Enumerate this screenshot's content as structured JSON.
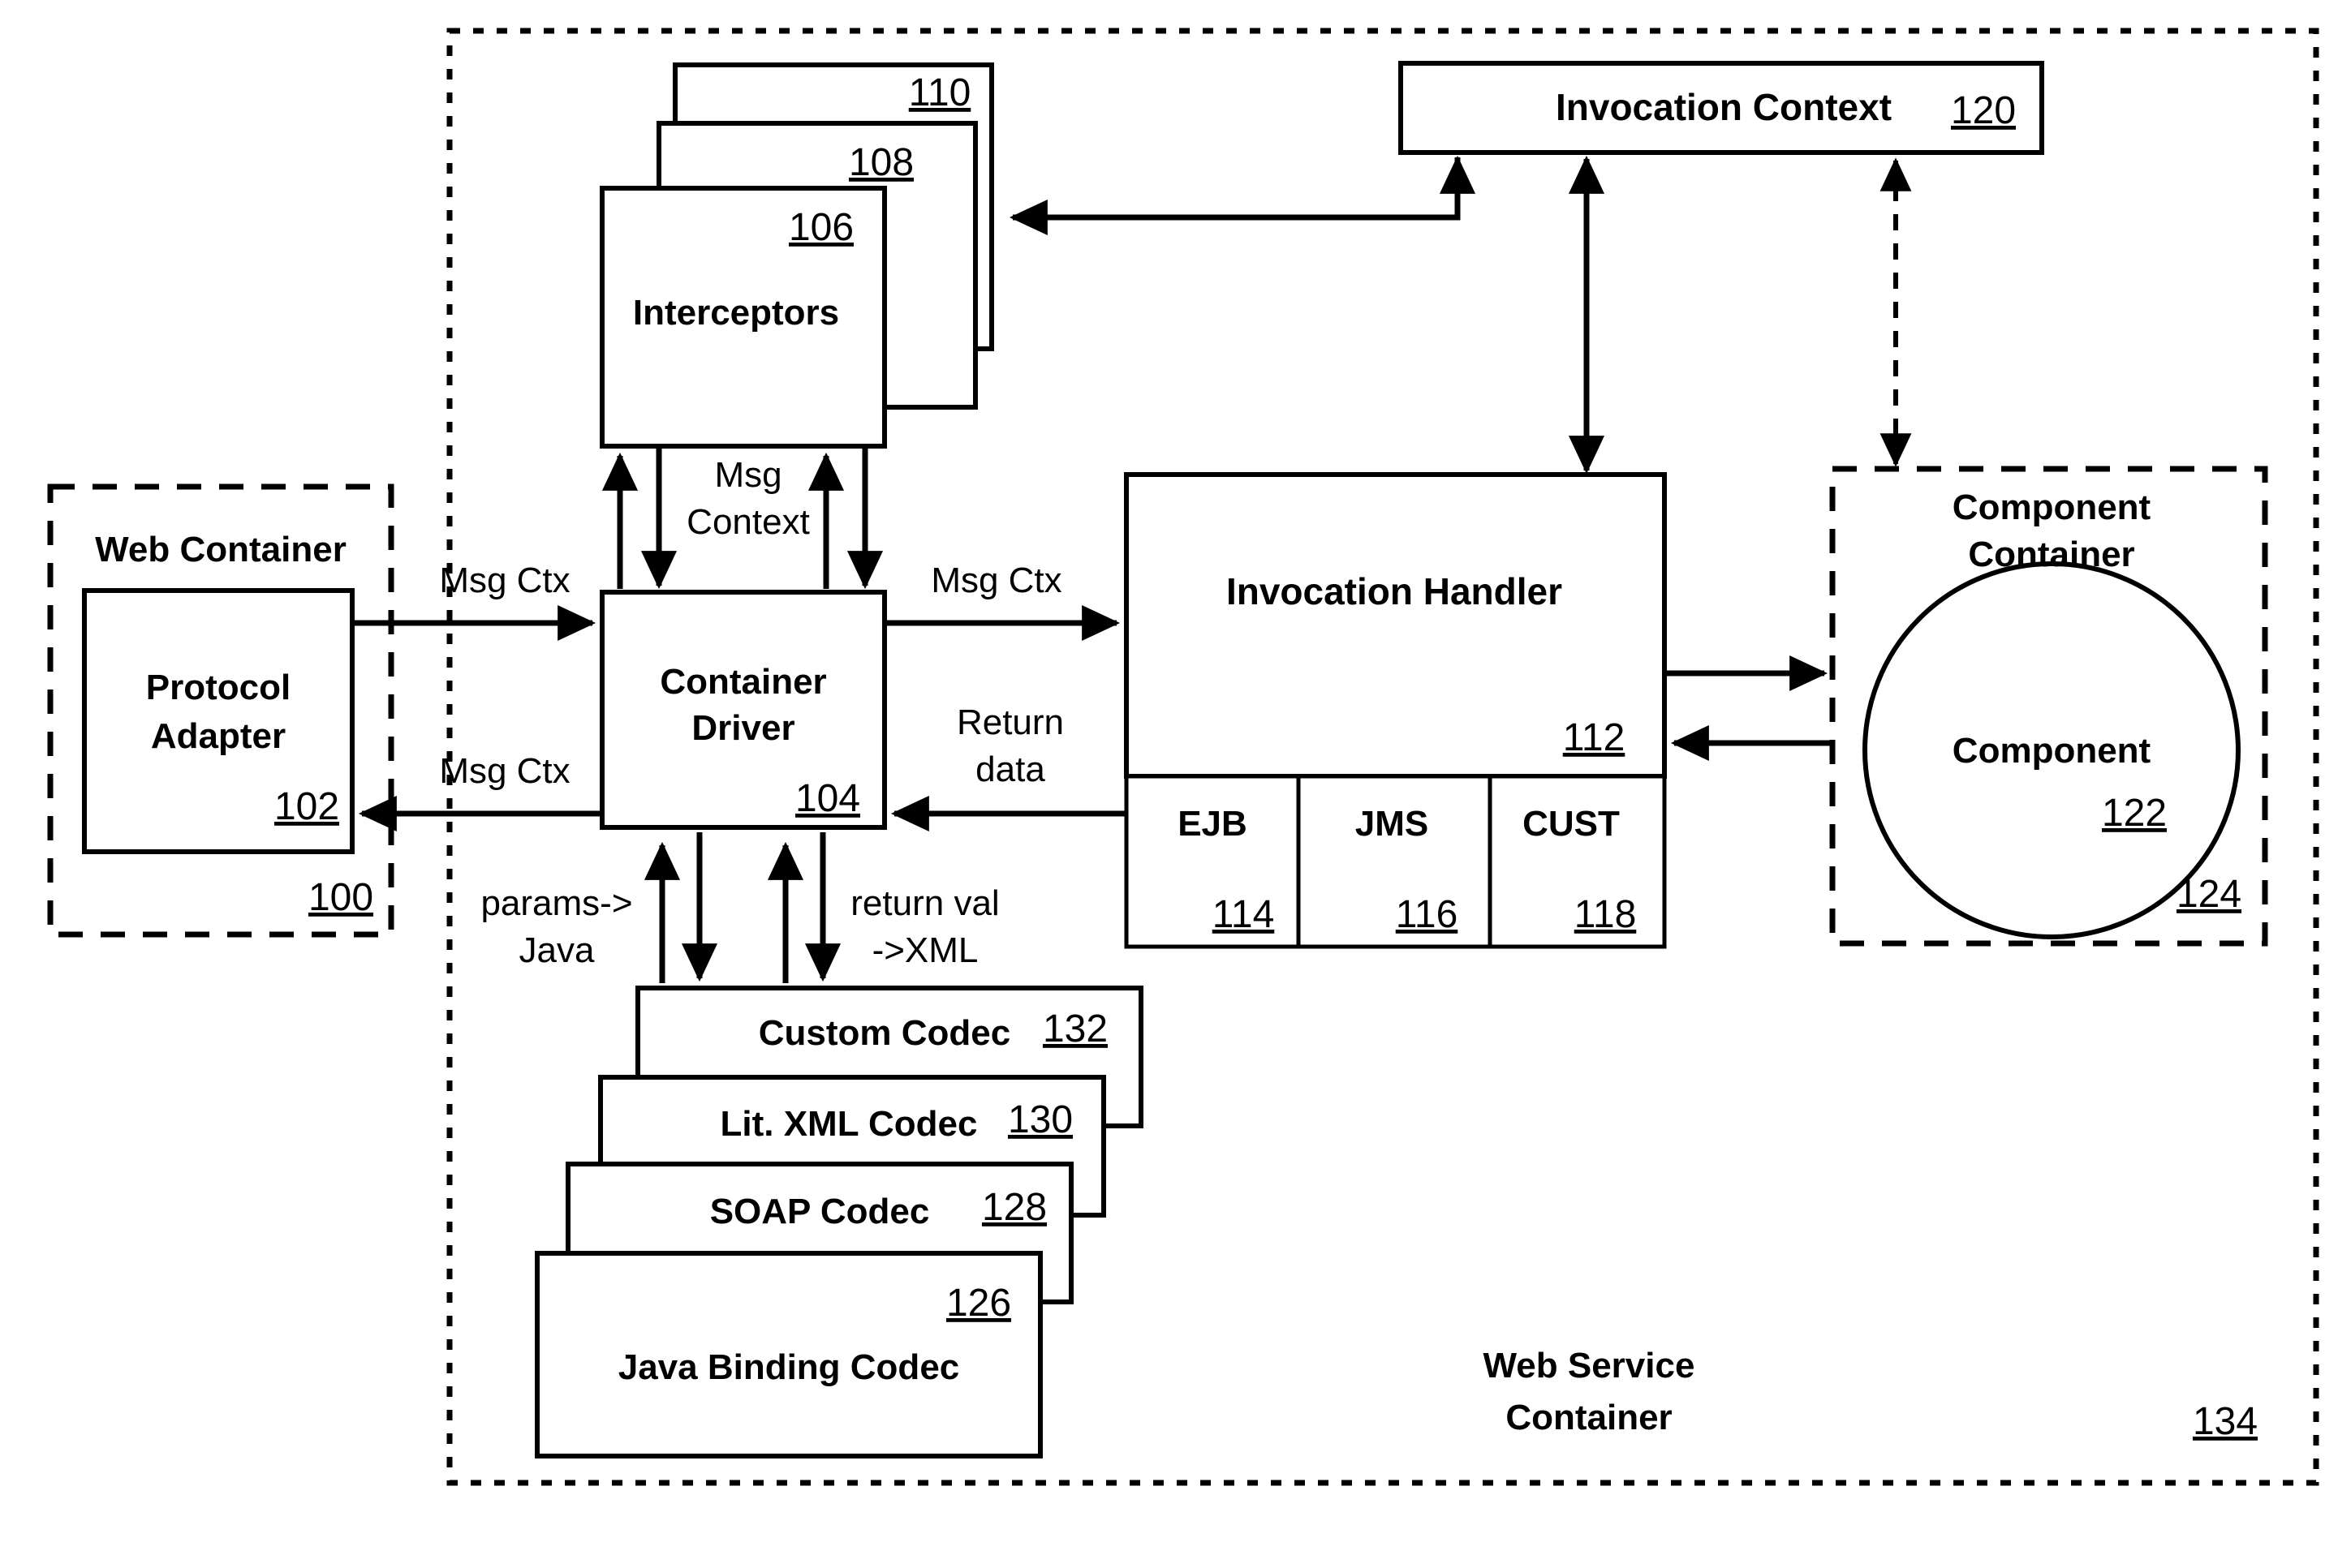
{
  "figure": {
    "title": "Web Service Container architecture block diagram",
    "outer_container": {
      "label_line1": "Web Service",
      "label_line2": "Container",
      "ref": "134"
    },
    "web_container": {
      "label": "Web Container",
      "ref": "100",
      "inner_box": {
        "label_line1": "Protocol",
        "label_line2": "Adapter",
        "ref": "102"
      }
    },
    "container_driver": {
      "label_line1": "Container",
      "label_line2": "Driver",
      "ref": "104"
    },
    "interceptors": {
      "label": "Interceptors",
      "ref_front": "106",
      "ref_middle": "108",
      "ref_back": "110"
    },
    "invocation_context": {
      "label": "Invocation Context",
      "ref": "120"
    },
    "invocation_handler": {
      "label": "Invocation Handler",
      "ref": "112",
      "sub_boxes": [
        {
          "label": "EJB",
          "ref": "114"
        },
        {
          "label": "JMS",
          "ref": "116"
        },
        {
          "label": "CUST",
          "ref": "118"
        }
      ]
    },
    "component_container": {
      "label_line1": "Component",
      "label_line2": "Container",
      "ref": "124",
      "component": {
        "label": "Component",
        "ref": "122"
      }
    },
    "codecs": [
      {
        "label": "Custom Codec",
        "ref": "132"
      },
      {
        "label": "Lit. XML Codec",
        "ref": "130"
      },
      {
        "label": "SOAP Codec",
        "ref": "128"
      },
      {
        "label": "Java Binding Codec",
        "ref": "126"
      }
    ],
    "edge_labels": {
      "msg_ctx_in": "Msg Ctx",
      "msg_ctx_out": "Msg Ctx",
      "msg_ctx_right": "Msg Ctx",
      "msg_context_line1": "Msg",
      "msg_context_line2": "Context",
      "return_data_line1": "Return",
      "return_data_line2": "data",
      "params_java_line1": "params->",
      "params_java_line2": "Java",
      "return_val_xml_line1": "return val",
      "return_val_xml_line2": "->XML"
    }
  },
  "colors": {
    "stroke": "#000000",
    "background": "#ffffff"
  }
}
